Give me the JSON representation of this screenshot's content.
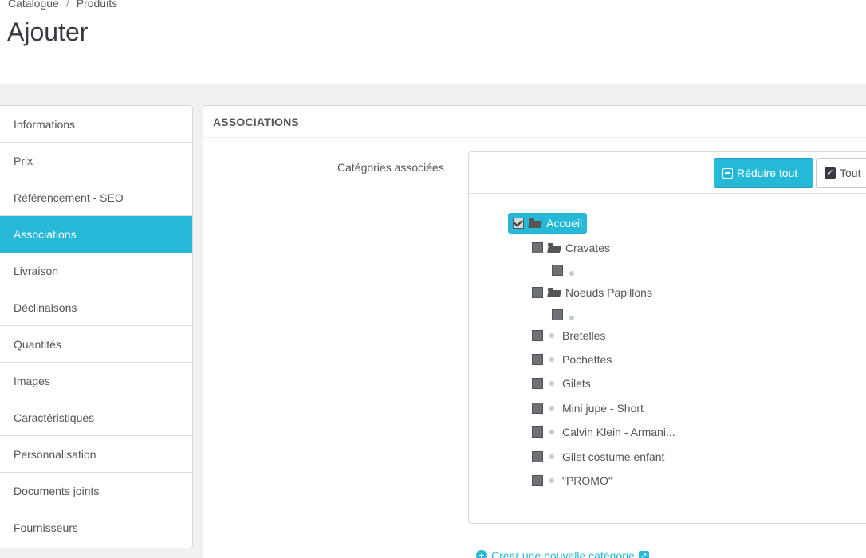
{
  "breadcrumb": {
    "items": [
      "Catalogue",
      "Produits"
    ],
    "separator": "/"
  },
  "page": {
    "title": "Ajouter"
  },
  "tabs": [
    {
      "label": "Informations",
      "active": false
    },
    {
      "label": "Prix",
      "active": false
    },
    {
      "label": "Référencement - SEO",
      "active": false
    },
    {
      "label": "Associations",
      "active": true
    },
    {
      "label": "Livraison",
      "active": false
    },
    {
      "label": "Déclinaisons",
      "active": false
    },
    {
      "label": "Quantités",
      "active": false
    },
    {
      "label": "Images",
      "active": false
    },
    {
      "label": "Caractéristiques",
      "active": false
    },
    {
      "label": "Personnalisation",
      "active": false
    },
    {
      "label": "Documents joints",
      "active": false
    },
    {
      "label": "Fournisseurs",
      "active": false
    }
  ],
  "panel": {
    "heading": "ASSOCIATIONS",
    "categories_label": "Catégories associées",
    "buttons": {
      "collapse_all": "Réduire tout",
      "check_all": "Tout"
    },
    "tree": {
      "root": "Accueil",
      "items": [
        {
          "label": "Cravates",
          "type": "folder"
        },
        {
          "label": "",
          "type": "leaf"
        },
        {
          "label": "Noeuds Papillons",
          "type": "folder"
        },
        {
          "label": "",
          "type": "leaf"
        },
        {
          "label": "Bretelles",
          "type": "leaf"
        },
        {
          "label": "Pochettes",
          "type": "leaf"
        },
        {
          "label": "Gilets",
          "type": "leaf"
        },
        {
          "label": "Mini jupe - Short",
          "type": "leaf"
        },
        {
          "label": "Calvin Klein - Armani...",
          "type": "leaf"
        },
        {
          "label": "Gilet costume enfant",
          "type": "leaf"
        },
        {
          "label": "\"PROMO\"",
          "type": "leaf"
        }
      ]
    },
    "create_link": "Créer une nouvelle catégorie"
  },
  "colors": {
    "accent": "#25b9d7",
    "text": "#363a41",
    "background": "#eff1f2"
  },
  "icons": {
    "collapse": "minus-square-icon",
    "check": "check-square-icon",
    "folder": "folder-open-icon",
    "bullet": "circle-icon",
    "add": "plus-circle-icon",
    "external": "external-link-icon"
  }
}
